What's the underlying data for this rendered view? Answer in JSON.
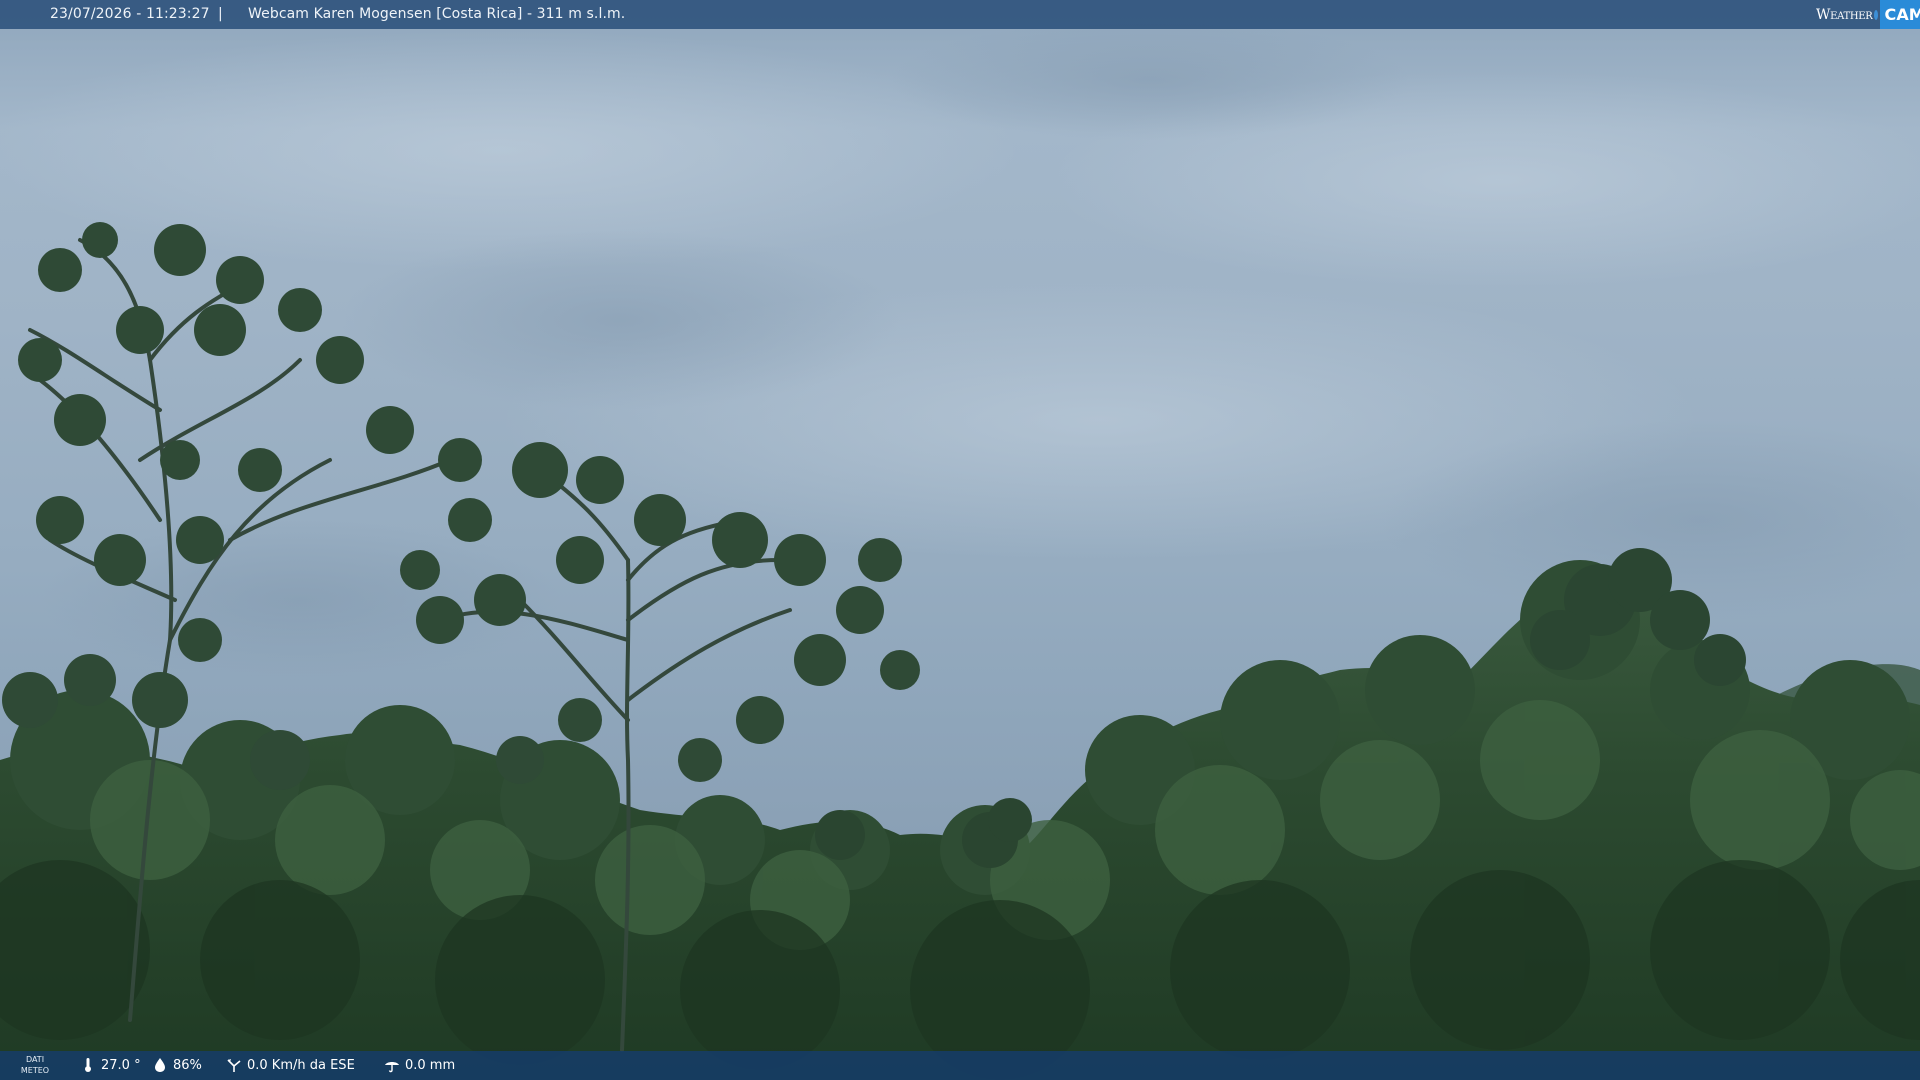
{
  "header": {
    "datetime": "23/07/2026 - 11:23:27",
    "separator": "|",
    "location": "Webcam Karen Mogensen [Costa Rica] - 311 m s.l.m."
  },
  "logo": {
    "weather_text": "Weather",
    "cam_text": "CAM"
  },
  "footer": {
    "meteo_label_line1": "DATI",
    "meteo_label_line2": "METEO",
    "temperature": "27.0 °",
    "humidity": "86%",
    "wind": "0.0 Km/h da ESE",
    "rain": "0.0 mm"
  },
  "icons": {
    "temperature": "thermometer-icon",
    "humidity": "humidity-drop-icon",
    "wind": "wind-icon",
    "rain": "rain-icon"
  },
  "colors": {
    "top_bar": "#244a76",
    "bottom_bar": "#163c68",
    "logo_accent": "#2a8bd8"
  }
}
